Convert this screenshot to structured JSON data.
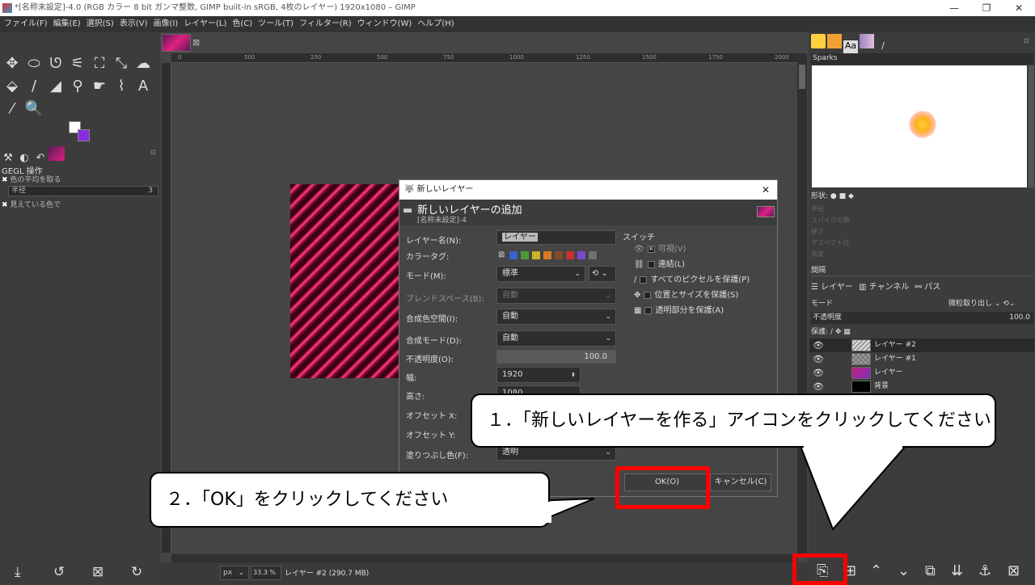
{
  "window": {
    "title": "*[名称未設定]-4.0 (RGB カラー 8 bit ガンマ整数, GIMP built-in sRGB, 4枚のレイヤー) 1920x1080 – GIMP",
    "min": "—",
    "max": "❐",
    "close": "✕"
  },
  "menu": [
    "ファイル(F)",
    "編集(E)",
    "選択(S)",
    "表示(V)",
    "画像(I)",
    "レイヤー(L)",
    "色(C)",
    "ツール(T)",
    "フィルター(R)",
    "ウィンドウ(W)",
    "ヘルプ(H)"
  ],
  "toolbox": {
    "icons": [
      "move-icon",
      "ellipse-select-icon",
      "lasso-icon",
      "fuzzy-select-icon",
      "crop-icon",
      "transform-icon",
      "warp-icon",
      "bucket-fill-icon",
      "paintbrush-icon",
      "eraser-icon",
      "clone-icon",
      "smudge-icon",
      "paths-icon",
      "text-icon",
      "color-picker-icon",
      "zoom-icon"
    ],
    "glyphs": [
      "✥",
      "⬭",
      "ᘎ",
      "⚟",
      "⛶",
      "⤡",
      "☁",
      "⬙",
      "∕",
      "◢",
      "⚲",
      "☛",
      "⌇",
      "A",
      "⁄",
      "🔍"
    ]
  },
  "tool_options": {
    "title": "GEGL 操作",
    "opt1": "色の平均を取る",
    "radius_label": "半径",
    "radius_value": "3",
    "opt2": "見えている色で"
  },
  "rulers": {
    "h": [
      "0",
      "500",
      "250",
      "500",
      "750",
      "1000",
      "1250",
      "1500",
      "1750",
      "2000"
    ]
  },
  "status": {
    "unit": "px",
    "zoom": "33.3 %",
    "message": "レイヤー #2 (290.7 MB)"
  },
  "dialog": {
    "title": "新しいレイヤー",
    "close": "✕",
    "header_title": "新しいレイヤーの追加",
    "header_sub": "[名称未設定]-4",
    "labels": {
      "name": "レイヤー名(N):",
      "color_tag": "カラータグ:",
      "mode": "モード(M):",
      "blend_space": "ブレンドスペース(B):",
      "composite_space": "合成色空間(I):",
      "composite_mode": "合成モード(D):",
      "opacity": "不透明度(O):",
      "width": "幅:",
      "height": "高さ:",
      "offset_x": "オフセット X:",
      "offset_y": "オフセット Y:",
      "fill": "塗りつぶし色(F):"
    },
    "values": {
      "name": "レイヤー",
      "mode": "標準",
      "blend_space": "自動",
      "composite_space": "自動",
      "composite_mode": "自動",
      "opacity": "100.0",
      "width": "1920",
      "height": "1080",
      "fill": "透明"
    },
    "color_tags": [
      "#888888",
      "#3a63c8",
      "#4a9a3a",
      "#c8b428",
      "#d87820",
      "#8a4a2a",
      "#c83030",
      "#7a4ac8",
      "#707070"
    ],
    "switch_title": "スイッチ",
    "switches": [
      "可視(V)",
      "連結(L)",
      "すべてのピクセルを保護(P)",
      "位置とサイズを保護(S)",
      "透明部分を保護(A)"
    ],
    "ok": "OK(O)",
    "cancel": "キャンセル(C)"
  },
  "right": {
    "brush_name": "Sparks",
    "shape_label": "形状:",
    "faded": [
      "半径",
      "スパイクの数",
      "硬さ",
      "アスペクト比",
      "角度",
      "間隔"
    ],
    "spacing_label": "間隔",
    "tab_layers": "レイヤー",
    "tab_channels": "チャンネル",
    "tab_paths": "パス",
    "mode_label": "モード",
    "mode_value": "微粒取り出し",
    "opacity_label": "不透明度",
    "opacity_value": "100.0",
    "protect_label": "保護:",
    "layers": [
      {
        "name": "レイヤー #2",
        "thumb": "#bbbbbb"
      },
      {
        "name": "レイヤー #1",
        "thumb": "#888888"
      },
      {
        "name": "レイヤー",
        "thumb": "#d020a0"
      },
      {
        "name": "背景",
        "thumb": "#000000"
      }
    ]
  },
  "callouts": {
    "step1": "１．「新しいレイヤーを作る」アイコンをクリックしてください",
    "step2": "２．「OK」をクリックしてください"
  }
}
